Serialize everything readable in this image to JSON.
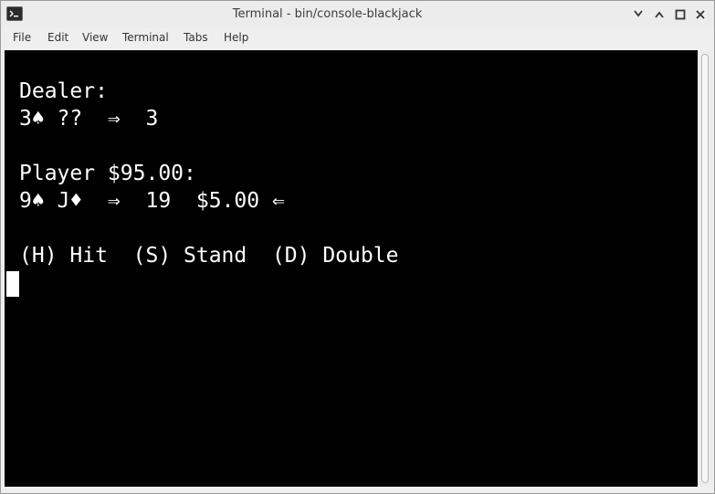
{
  "window": {
    "title": "Terminal - bin/console-blackjack",
    "app_icon": "terminal-icon",
    "controls": [
      "minimize-icon",
      "maximize-icon",
      "close-icon"
    ]
  },
  "menu": {
    "items": [
      "File",
      "Edit",
      "View",
      "Terminal",
      "Tabs",
      "Help"
    ]
  },
  "terminal": {
    "background": "#000000",
    "foreground": "#ffffff",
    "lines": [
      "Dealer:",
      "3♠ ??  ⇒  3",
      "",
      "Player $95.00:",
      "9♠ J♦  ⇒  19  $5.00 ⇐",
      "",
      "(H) Hit  (S) Stand  (D) Double"
    ]
  }
}
